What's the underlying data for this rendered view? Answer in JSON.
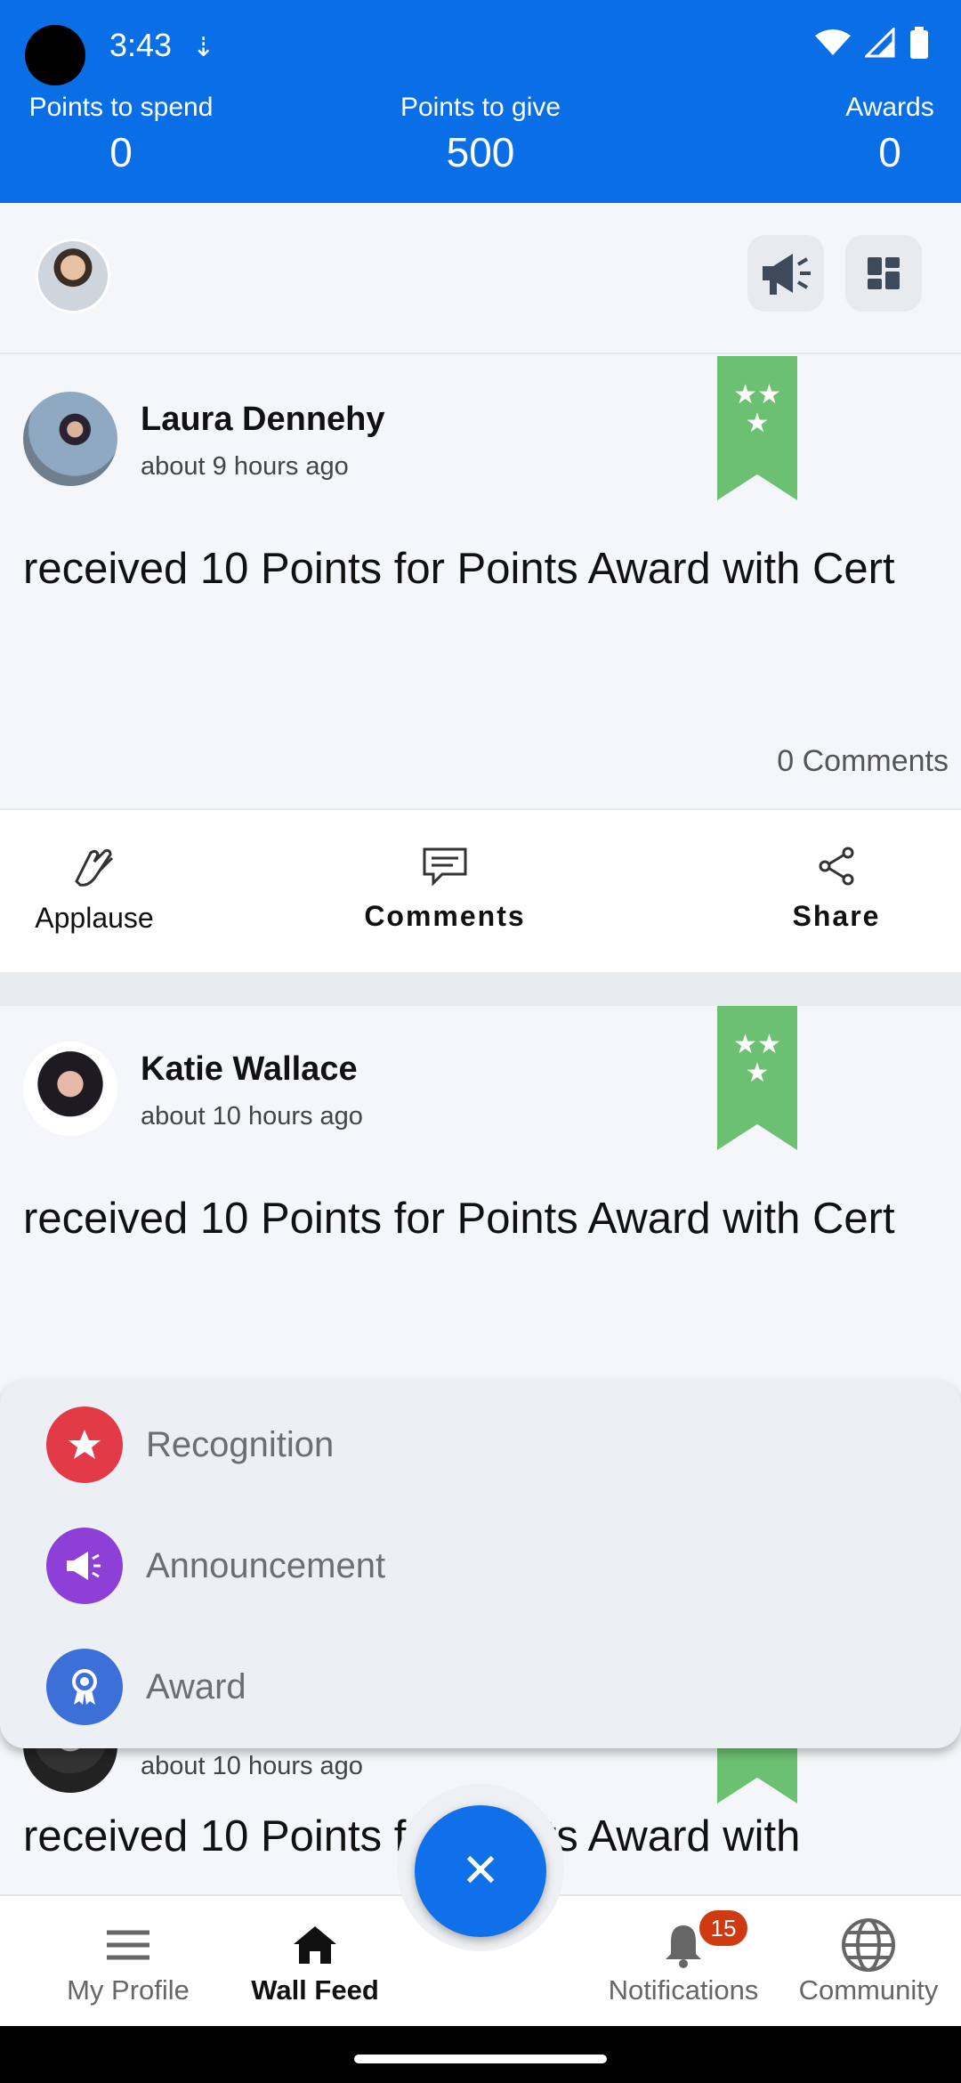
{
  "status_bar": {
    "time": "3:43"
  },
  "stats": [
    {
      "label": "Points to spend",
      "value": "0"
    },
    {
      "label": "Points to give",
      "value": "500"
    },
    {
      "label": "Awards",
      "value": "0"
    }
  ],
  "posts": [
    {
      "author": "Laura Dennehy",
      "time_ago": "about 9 hours ago",
      "text": "received 10 Points for Points Award with Cert",
      "comments_count": "0 Comments"
    },
    {
      "author": "Katie Wallace",
      "time_ago": "about 10 hours ago",
      "text": "received 10 Points for Points Award with Cert"
    },
    {
      "time_ago": "about 10 hours ago",
      "text": "received 10 Points for Points Award with"
    }
  ],
  "actions": {
    "applause": "Applause",
    "comments": "Comments",
    "share": "Share"
  },
  "speed_dial": [
    {
      "label": "Recognition",
      "color": "#e23a47"
    },
    {
      "label": "Announcement",
      "color": "#8e3fd8"
    },
    {
      "label": "Award",
      "color": "#3c6fd8"
    }
  ],
  "bottom_nav": [
    {
      "label": "My Profile"
    },
    {
      "label": "Wall Feed"
    },
    {
      "label": "Notifications",
      "badge": "15"
    },
    {
      "label": "Community"
    }
  ]
}
